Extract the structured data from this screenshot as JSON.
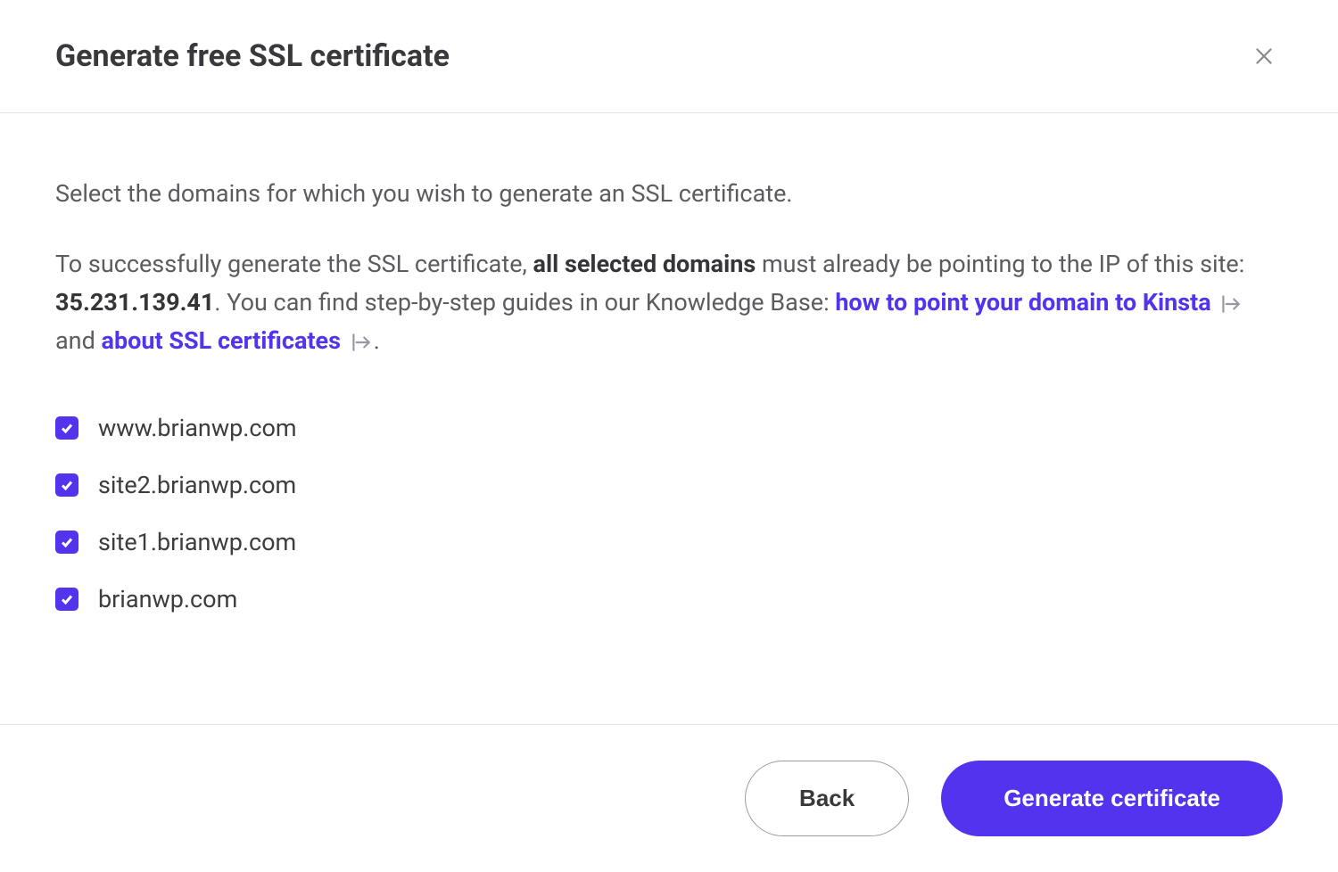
{
  "header": {
    "title": "Generate free SSL certificate"
  },
  "body": {
    "intro": "Select the domains for which you wish to generate an SSL certificate.",
    "info_prefix": "To successfully generate the SSL certificate, ",
    "info_bold1": "all selected domains",
    "info_mid1": " must already be pointing to the IP of this site: ",
    "info_ip": "35.231.139.41",
    "info_mid2": ". You can find step-by-step guides in our Knowledge Base: ",
    "link1": "how to point your domain to Kinsta",
    "info_and": " and ",
    "link2": "about SSL certificates",
    "info_period": ".",
    "domains": [
      {
        "label": "www.brianwp.com",
        "checked": true
      },
      {
        "label": "site2.brianwp.com",
        "checked": true
      },
      {
        "label": "site1.brianwp.com",
        "checked": true
      },
      {
        "label": "brianwp.com",
        "checked": true
      }
    ]
  },
  "footer": {
    "back_label": "Back",
    "generate_label": "Generate certificate"
  }
}
